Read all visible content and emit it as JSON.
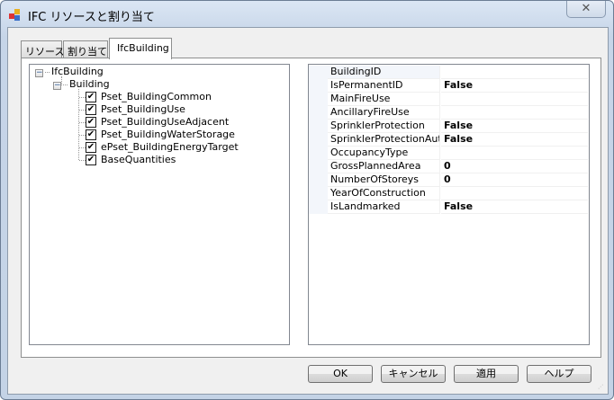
{
  "window": {
    "title": "IFC リソースと割り当て",
    "close_icon": "close-icon"
  },
  "tabs": [
    {
      "label": "リソース"
    },
    {
      "label": "割り当て"
    },
    {
      "label": "IfcBuilding",
      "active": true
    }
  ],
  "tree": {
    "root": "IfcBuilding",
    "child": "Building",
    "items": [
      {
        "label": "Pset_BuildingCommon",
        "checked": true
      },
      {
        "label": "Pset_BuildingUse",
        "checked": true
      },
      {
        "label": "Pset_BuildingUseAdjacent",
        "checked": true
      },
      {
        "label": "Pset_BuildingWaterStorage",
        "checked": true
      },
      {
        "label": "ePset_BuildingEnergyTarget",
        "checked": true
      },
      {
        "label": "BaseQuantities",
        "checked": true
      }
    ]
  },
  "properties": [
    {
      "name": "BuildingID",
      "value": ""
    },
    {
      "name": "IsPermanentID",
      "value": "False"
    },
    {
      "name": "MainFireUse",
      "value": ""
    },
    {
      "name": "AncillaryFireUse",
      "value": ""
    },
    {
      "name": "SprinklerProtection",
      "value": "False"
    },
    {
      "name": "SprinklerProtectionAuto",
      "value": "False"
    },
    {
      "name": "OccupancyType",
      "value": ""
    },
    {
      "name": "GrossPlannedArea",
      "value": "0"
    },
    {
      "name": "NumberOfStoreys",
      "value": "0"
    },
    {
      "name": "YearOfConstruction",
      "value": ""
    },
    {
      "name": "IsLandmarked",
      "value": "False"
    }
  ],
  "buttons": {
    "ok": "OK",
    "cancel": "キャンセル",
    "apply": "適用",
    "help": "ヘルプ"
  }
}
